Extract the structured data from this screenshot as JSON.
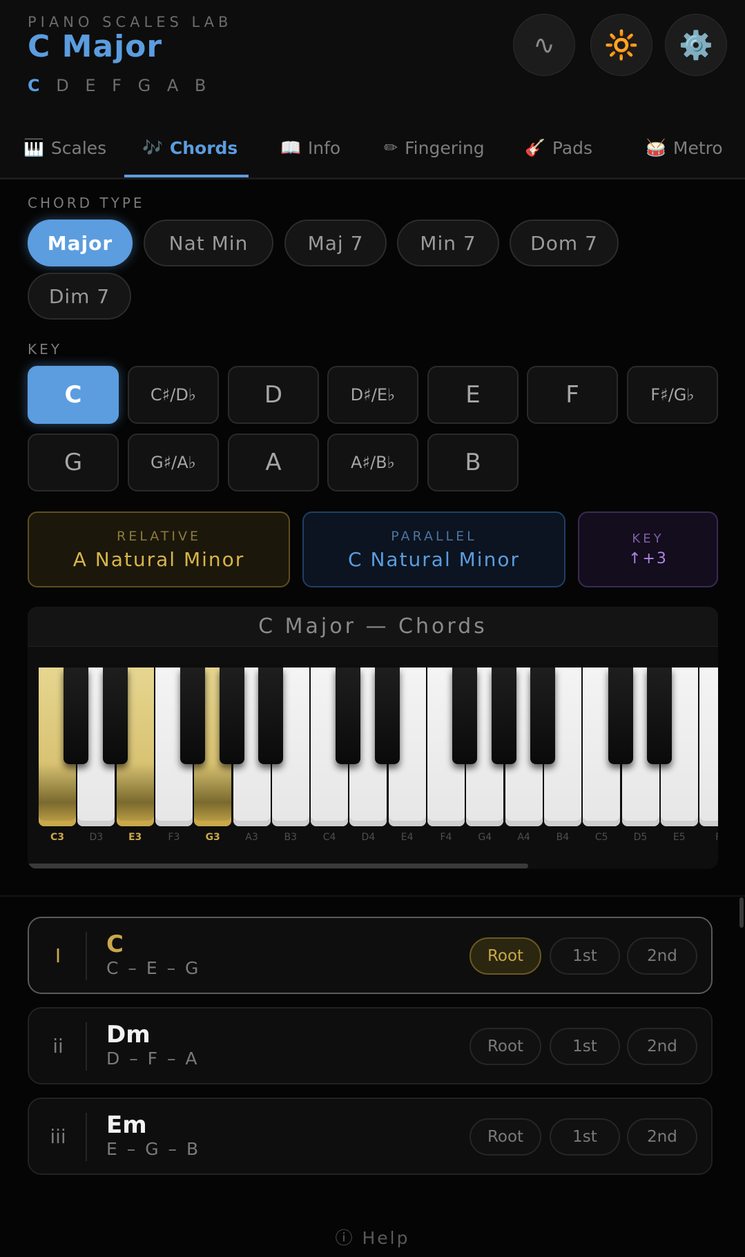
{
  "header": {
    "kicker": "PIANO SCALES LAB",
    "title": "C Major",
    "notes_root": "C",
    "notes_rest": "D E F G A B",
    "wave_icon": "∿",
    "sun_icon": "🔆",
    "gear_icon": "⚙️"
  },
  "tabs": [
    {
      "icon": "🎹",
      "label": "Scales"
    },
    {
      "icon": "🎶",
      "label": "Chords"
    },
    {
      "icon": "📖",
      "label": "Info"
    },
    {
      "icon": "✏",
      "label": "Fingering"
    },
    {
      "icon": "🎸",
      "label": "Pads"
    },
    {
      "icon": "🥁",
      "label": "Metro"
    }
  ],
  "active_tab": "Chords",
  "chord_type": {
    "label": "CHORD TYPE",
    "options": [
      "Major",
      "Nat Min",
      "Maj 7",
      "Min 7",
      "Dom 7",
      "Dim 7"
    ],
    "selected": "Major"
  },
  "key": {
    "label": "KEY",
    "options": [
      "C",
      "C♯/D♭",
      "D",
      "D♯/E♭",
      "E",
      "F",
      "F♯/G♭",
      "G",
      "G♯/A♭",
      "A",
      "A♯/B♭",
      "B"
    ],
    "selected": "C"
  },
  "related": {
    "relative_label": "RELATIVE",
    "relative_value": "A Natural Minor",
    "parallel_label": "PARALLEL",
    "parallel_value": "C Natural Minor",
    "key_label": "KEY",
    "key_value": "↑+3"
  },
  "keyboard": {
    "title": "C Major — Chords",
    "white_keys": [
      "C3",
      "D3",
      "E3",
      "F3",
      "G3",
      "A3",
      "B3",
      "C4",
      "D4",
      "E4",
      "F4",
      "G4",
      "A4",
      "B4",
      "C5",
      "D5",
      "E5",
      "F"
    ],
    "highlighted": [
      "C3",
      "E3",
      "G3"
    ],
    "highlight_color": "#d9c373"
  },
  "chords": [
    {
      "roman": "I",
      "name": "C",
      "notes": "C – E – G",
      "inversions": [
        "Root",
        "1st",
        "2nd"
      ],
      "active_inversion": "Root",
      "selected": true
    },
    {
      "roman": "ii",
      "name": "Dm",
      "notes": "D – F – A",
      "inversions": [
        "Root",
        "1st",
        "2nd"
      ],
      "active_inversion": null,
      "selected": false
    },
    {
      "roman": "iii",
      "name": "Em",
      "notes": "E – G – B",
      "inversions": [
        "Root",
        "1st",
        "2nd"
      ],
      "active_inversion": null,
      "selected": false
    }
  ],
  "help": "ⓘ Help",
  "colors": {
    "accent": "#5b9ddf",
    "gold": "#c9a84a",
    "purple": "#b084e8",
    "background": "#050505"
  }
}
